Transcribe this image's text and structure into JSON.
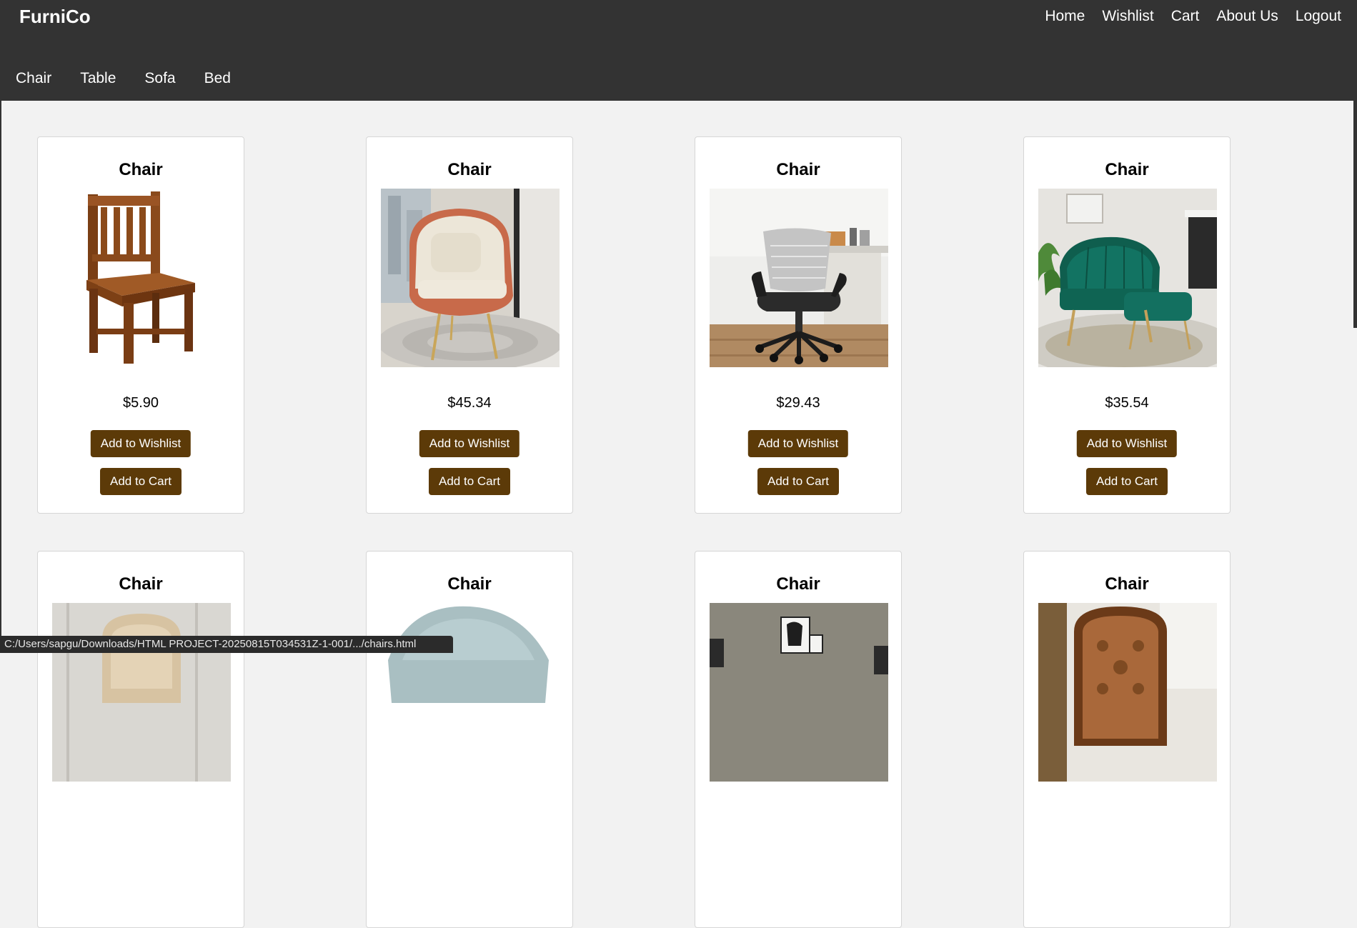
{
  "brand": "FurniCo",
  "top_nav": [
    "Home",
    "Wishlist",
    "Cart",
    "About Us",
    "Logout"
  ],
  "category_nav": [
    "Chair",
    "Table",
    "Sofa",
    "Bed"
  ],
  "products": [
    {
      "title": "Chair",
      "price": "$5.90",
      "image": "wooden-chair",
      "wishlist_label": "Add to Wishlist",
      "cart_label": "Add to Cart"
    },
    {
      "title": "Chair",
      "price": "$45.34",
      "image": "armchair-cream",
      "wishlist_label": "Add to Wishlist",
      "cart_label": "Add to Cart"
    },
    {
      "title": "Chair",
      "price": "$29.43",
      "image": "office-chair",
      "wishlist_label": "Add to Wishlist",
      "cart_label": "Add to Cart"
    },
    {
      "title": "Chair",
      "price": "$35.54",
      "image": "green-velvet-chair",
      "wishlist_label": "Add to Wishlist",
      "cart_label": "Add to Cart"
    },
    {
      "title": "Chair",
      "image": "beige-chair"
    },
    {
      "title": "Chair",
      "image": "gray-shell-chair"
    },
    {
      "title": "Chair",
      "image": "desk-chair-room"
    },
    {
      "title": "Chair",
      "image": "ornate-chair"
    }
  ],
  "status_bar": "C:/Users/sapgu/Downloads/HTML PROJECT-20250815T034531Z-1-001/.../chairs.html",
  "colors": {
    "header_bg": "#333333",
    "page_bg": "#f2f2f2",
    "button_bg": "#5c3a08",
    "button_text": "#ffffff"
  }
}
